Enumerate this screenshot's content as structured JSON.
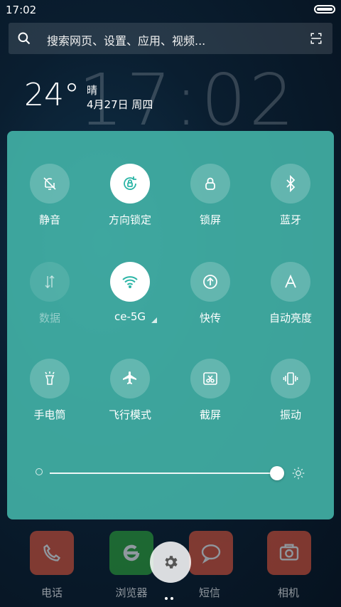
{
  "status_bar": {
    "time": "17:02"
  },
  "search": {
    "placeholder": "搜索网页、设置、应用、视频..."
  },
  "clock_widget": {
    "big_time": "17:02",
    "temperature": "24°",
    "weather": "晴",
    "date": "4月27日 周四"
  },
  "quick_settings": {
    "tiles": [
      {
        "label": "静音",
        "icon": "bell-off-icon",
        "state": "off"
      },
      {
        "label": "方向锁定",
        "icon": "rotation-lock-icon",
        "state": "on"
      },
      {
        "label": "锁屏",
        "icon": "lock-icon",
        "state": "off"
      },
      {
        "label": "蓝牙",
        "icon": "bluetooth-icon",
        "state": "off"
      },
      {
        "label": "数据",
        "icon": "mobile-data-icon",
        "state": "disabled"
      },
      {
        "label": "ce-5G",
        "icon": "wifi-icon",
        "state": "on"
      },
      {
        "label": "快传",
        "icon": "upload-icon",
        "state": "off"
      },
      {
        "label": "自动亮度",
        "icon": "auto-brightness-icon",
        "state": "off"
      },
      {
        "label": "手电筒",
        "icon": "flashlight-icon",
        "state": "off"
      },
      {
        "label": "飞行模式",
        "icon": "airplane-icon",
        "state": "off"
      },
      {
        "label": "截屏",
        "icon": "screenshot-icon",
        "state": "off"
      },
      {
        "label": "振动",
        "icon": "vibrate-icon",
        "state": "off"
      }
    ],
    "brightness": {
      "value": 0.97
    }
  },
  "dock": [
    {
      "label": "电话",
      "color": "#e2553b"
    },
    {
      "label": "浏览器",
      "color": "#2fa83a"
    },
    {
      "label": "短信",
      "color": "#e2553b"
    },
    {
      "label": "相机",
      "color": "#e2553b"
    }
  ],
  "colors": {
    "panel": "#46baae",
    "accent": "#2bb5a6"
  }
}
